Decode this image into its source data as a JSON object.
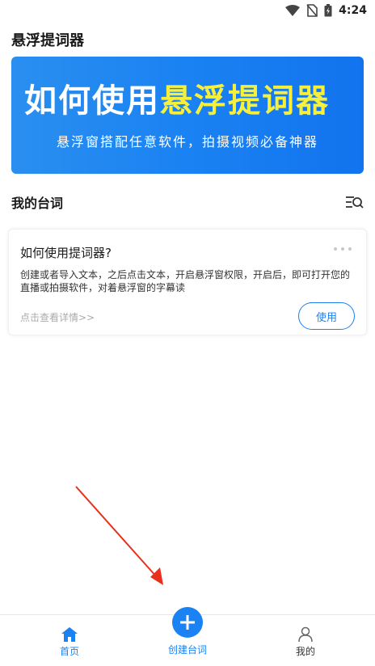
{
  "status_bar": {
    "time": "4:24"
  },
  "app_title": "悬浮提词器",
  "banner": {
    "headline_white": "如何使用",
    "headline_yellow": "悬浮提词器",
    "subtitle": "悬浮窗搭配任意软件，拍摄视频必备神器"
  },
  "section": {
    "title": "我的台词"
  },
  "card": {
    "title": "如何使用提词器?",
    "description": "创建或者导入文本，之后点击文本，开启悬浮窗权限，开启后，即可打开您的直播或拍摄软件，对着悬浮窗的字幕读",
    "detail_link": "点击查看详情>>",
    "use_label": "使用"
  },
  "bottom_nav": {
    "home": "首页",
    "create": "创建台词",
    "mine": "我的"
  },
  "colors": {
    "accent": "#1a82f2",
    "banner_yellow": "#f6ef3c",
    "arrow_red": "#e8301c"
  }
}
